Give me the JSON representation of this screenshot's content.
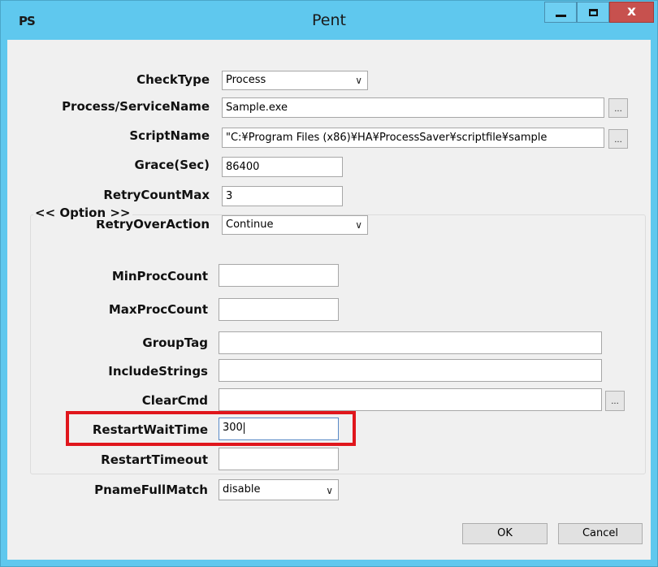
{
  "window": {
    "app_icon": "PS",
    "title": "Pent",
    "controls": {
      "minimize": "minimize",
      "maximize": "maximize",
      "close": "x"
    }
  },
  "form": {
    "check_type": {
      "label": "CheckType",
      "value": "Process"
    },
    "process_service_name": {
      "label": "Process/ServiceName",
      "value": "Sample.exe",
      "browse": "..."
    },
    "script_name": {
      "label": "ScriptName",
      "value": "\"C:¥Program Files (x86)¥HA¥ProcessSaver¥scriptfile¥sample",
      "browse": "..."
    },
    "grace_sec": {
      "label": "Grace(Sec)",
      "value": "86400"
    },
    "retry_count_max": {
      "label": "RetryCountMax",
      "value": "3"
    },
    "retry_over_action": {
      "label": "RetryOverAction",
      "value": "Continue"
    }
  },
  "option": {
    "title": "<< Option >>",
    "min_proc_count": {
      "label": "MinProcCount",
      "value": ""
    },
    "max_proc_count": {
      "label": "MaxProcCount",
      "value": ""
    },
    "group_tag": {
      "label": "GroupTag",
      "value": ""
    },
    "include_strings": {
      "label": "IncludeStrings",
      "value": ""
    },
    "clear_cmd": {
      "label": "ClearCmd",
      "value": "",
      "browse": "..."
    },
    "restart_wait_time": {
      "label": "RestartWaitTime",
      "value": "300"
    },
    "restart_timeout": {
      "label": "RestartTimeout",
      "value": ""
    },
    "pname_full_match": {
      "label": "PnameFullMatch",
      "value": "disable"
    }
  },
  "buttons": {
    "ok": "OK",
    "cancel": "Cancel"
  },
  "colors": {
    "titlebar": "#5fc8ee",
    "close_button": "#c7514e",
    "highlight": "#e0161c"
  }
}
